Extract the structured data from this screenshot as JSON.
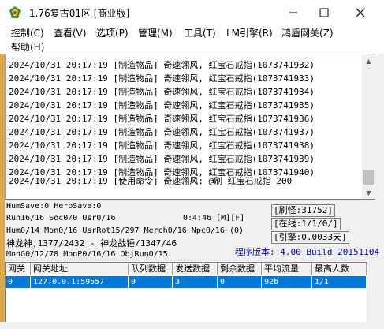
{
  "window": {
    "title": "1.76复古01区 [商业版]"
  },
  "icons": {
    "app": "app-icon",
    "minimize": "minimize-icon",
    "maximize": "maximize-icon",
    "close": "close-icon"
  },
  "menu": [
    {
      "label": "控制(C)"
    },
    {
      "label": "查看(V)"
    },
    {
      "label": "选项(P)"
    },
    {
      "label": "管理(M)"
    },
    {
      "label": "工具(T)"
    },
    {
      "label": "LM引擎(R)"
    },
    {
      "label": "鸿盾网关(Z)"
    },
    {
      "label": "帮助(H)"
    }
  ],
  "log": [
    "2024/10/31 20:17:19 [制造物品] 奇速翎风, 红宝石戒指(1073741932)",
    "2024/10/31 20:17:19 [制造物品] 奇速翎风, 红宝石戒指(1073741933)",
    "2024/10/31 20:17:19 [制造物品] 奇速翎风, 红宝石戒指(1073741934)",
    "2024/10/31 20:17:19 [制造物品] 奇速翎风, 红宝石戒指(1073741935)",
    "2024/10/31 20:17:19 [制造物品] 奇速翎风, 红宝石戒指(1073741936)",
    "2024/10/31 20:17:19 [制造物品] 奇速翎风, 红宝石戒指(1073741937)",
    "2024/10/31 20:17:19 [制造物品] 奇速翎风, 红宝石戒指(1073741938)",
    "2024/10/31 20:17:19 [制造物品] 奇速翎风, 红宝石戒指(1073741939)",
    "2024/10/31 20:17:19 [制造物品] 奇速翎风, 红宝石戒指(1073741940)",
    "2024/10/31 20:17:19 [使用命令] 奇速翎风: @刷 红宝石戒指 200"
  ],
  "status": {
    "line1": "HumSave:0 HeroSave:0",
    "line2": "Run16/16 Soc0/0 Usr0/16",
    "timer": "0:4:46 [M][F]",
    "line3": "Hum0/14 Mon0/16 UsrRot15/297 Merch0/16 Npc0/16 (0)",
    "line4": "神龙神,1377/2432 - 神龙战锤/1347/46",
    "line5": "MonG0/12/78 MonP0/16/16 ObjRun0/15",
    "refresh": "[刷怪:31752]",
    "online": "[在线:1/1/0/]",
    "engine": "[引擎:0.0033天]",
    "version": "程序版本: 4.00 Build 20151104"
  },
  "gateway": {
    "headers": [
      "网关",
      "网关地址",
      "队列数据",
      "发送数据",
      "剩余数据",
      "平均流量",
      "最高人数"
    ],
    "rows": [
      [
        "0",
        "127.0.0.1:59557",
        "0",
        "3",
        "0",
        "92b",
        "1/1"
      ]
    ]
  },
  "colors": {
    "selection": "#0078d7",
    "version_text": "#0000cc",
    "gutter": "#d9a94a"
  }
}
